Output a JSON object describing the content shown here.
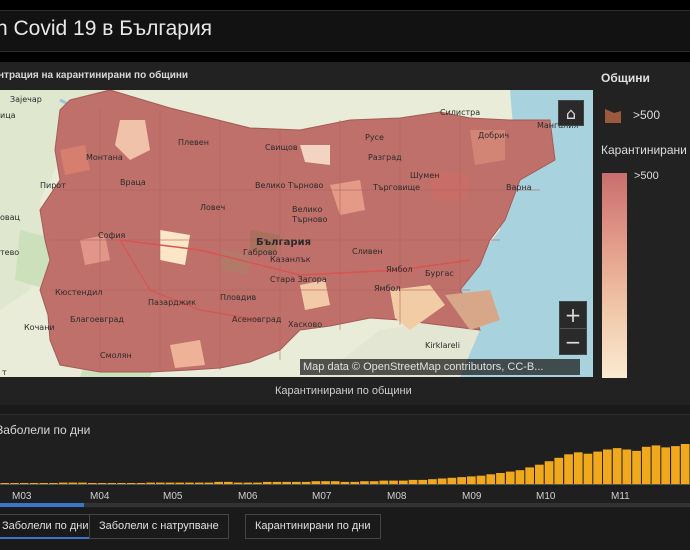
{
  "header": {
    "title": "n Covid 19 в България"
  },
  "map": {
    "title": "нтрация на карантинирани по общини",
    "caption": "Карантинирани по общини",
    "attribution": "Map data © OpenStreetMap contributors, CC-B...",
    "home_icon": "home-icon",
    "zoom_in": "+",
    "zoom_out": "−",
    "labels": {
      "zaječar": "Зајечар",
      "pirot": "Пирот",
      "sofia": "София",
      "montana": "Монтана",
      "vratsa": "Враца",
      "pleven": "Плевен",
      "svishtov": "Свищов",
      "ruse": "Русе",
      "razgrad": "Разград",
      "silistra": "Силистра",
      "dobrich": "Добрич",
      "mangalia": "Мангалия",
      "shumen": "Шумен",
      "varna": "Варна",
      "targovishte": "Търговище",
      "veliko": "Велико Търново",
      "lovech": "Ловеч",
      "gabrovo": "Габрово",
      "velik": "Велико",
      "tarnovo": "Търново",
      "bulgaria": "България",
      "kazanlak": "Казанлък",
      "sliven": "Сливен",
      "yambol": "Ямбол",
      "burgas": "Бургас",
      "stara": "Стара Загора",
      "pazardzhik": "Пазарджик",
      "plovdiv": "Пловдив",
      "asenovgrad": "Асеновград",
      "haskovo": "Хасково",
      "blagoevgrad": "Благоевград",
      "smolyan": "Смолян",
      "kyustendil": "Кюстендил",
      "kochani": "Кочани",
      "kirklareli": "Kirklareli",
      "yambol_region": "Ямбол",
      "tovac": "овац",
      "tsa": "ица",
      "tevo": "тево",
      "t": "т"
    }
  },
  "legend": {
    "title": "Общини",
    "swatch_label": ">500",
    "subtitle": "Карантинирани",
    "ramp_label": ">500",
    "swatch_color": "#9b5a3e"
  },
  "chart": {
    "title": "Заболели по дни",
    "bar_color": "#f0a81c",
    "chart_data": {
      "type": "bar",
      "title": "Заболели по дни",
      "xlabel": "",
      "ylabel": "",
      "categories": [
        "M03",
        "M04",
        "M05",
        "M06",
        "M07",
        "M08",
        "M09",
        "M10",
        "M11"
      ],
      "series": [
        {
          "values": [
            1,
            1,
            1,
            1,
            1,
            1,
            2,
            2,
            2,
            1,
            1,
            1,
            1,
            1,
            1,
            2,
            2,
            2,
            2,
            2,
            2,
            2,
            3,
            3,
            2,
            2,
            2,
            3,
            3,
            3,
            3,
            3,
            4,
            4,
            4,
            3,
            3,
            4,
            4,
            5,
            5,
            5,
            6,
            6,
            7,
            8,
            9,
            10,
            11,
            12,
            14,
            16,
            18,
            20,
            24,
            28,
            33,
            38,
            43,
            46,
            44,
            47,
            50,
            52,
            50,
            48,
            54,
            56,
            53,
            55,
            58
          ]
        }
      ]
    }
  },
  "tabs": [
    {
      "label": "Заболели по дни",
      "active": true
    },
    {
      "label": "Заболели с натрупване",
      "active": false
    },
    {
      "label": "Карантинирани по дни",
      "active": false
    }
  ]
}
